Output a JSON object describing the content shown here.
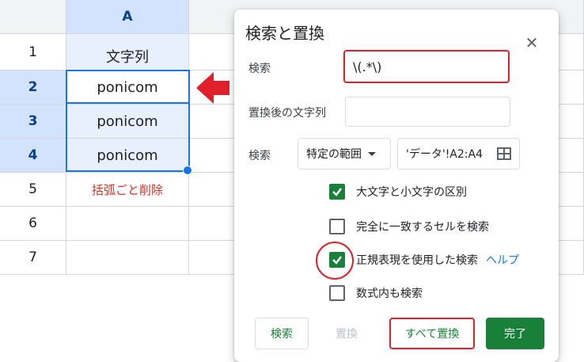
{
  "sheet": {
    "column_header": "A",
    "rows": [
      {
        "num": "1",
        "value": "文字列"
      },
      {
        "num": "2",
        "value": "ponicom"
      },
      {
        "num": "3",
        "value": "ponicom"
      },
      {
        "num": "4",
        "value": "ponicom"
      },
      {
        "num": "5",
        "value": "括弧ごと削除"
      },
      {
        "num": "6",
        "value": ""
      },
      {
        "num": "7",
        "value": ""
      }
    ]
  },
  "dialog": {
    "title": "検索と置換",
    "find_label": "検索",
    "find_value": "\\(.*\\)",
    "replace_label": "置換後の文字列",
    "replace_value": "",
    "search_label": "検索",
    "scope_value": "特定の範囲",
    "range_value": "'データ'!A2:A4",
    "options": {
      "match_case": "大文字と小文字の区別",
      "match_entire": "完全に一致するセルを検索",
      "regex": "正規表現を使用した検索",
      "formulas": "数式内も検索"
    },
    "help_link": "ヘルプ",
    "buttons": {
      "find": "検索",
      "replace": "置換",
      "replace_all": "すべて置換",
      "done": "完了"
    }
  },
  "colors": {
    "annotation_red": "#e0202a",
    "accent_green": "#188038",
    "selection_blue": "#1a73e8"
  },
  "icons": [
    "close-icon",
    "dropdown-caret-icon",
    "grid-select-icon",
    "check-icon",
    "arrow-left-icon"
  ]
}
